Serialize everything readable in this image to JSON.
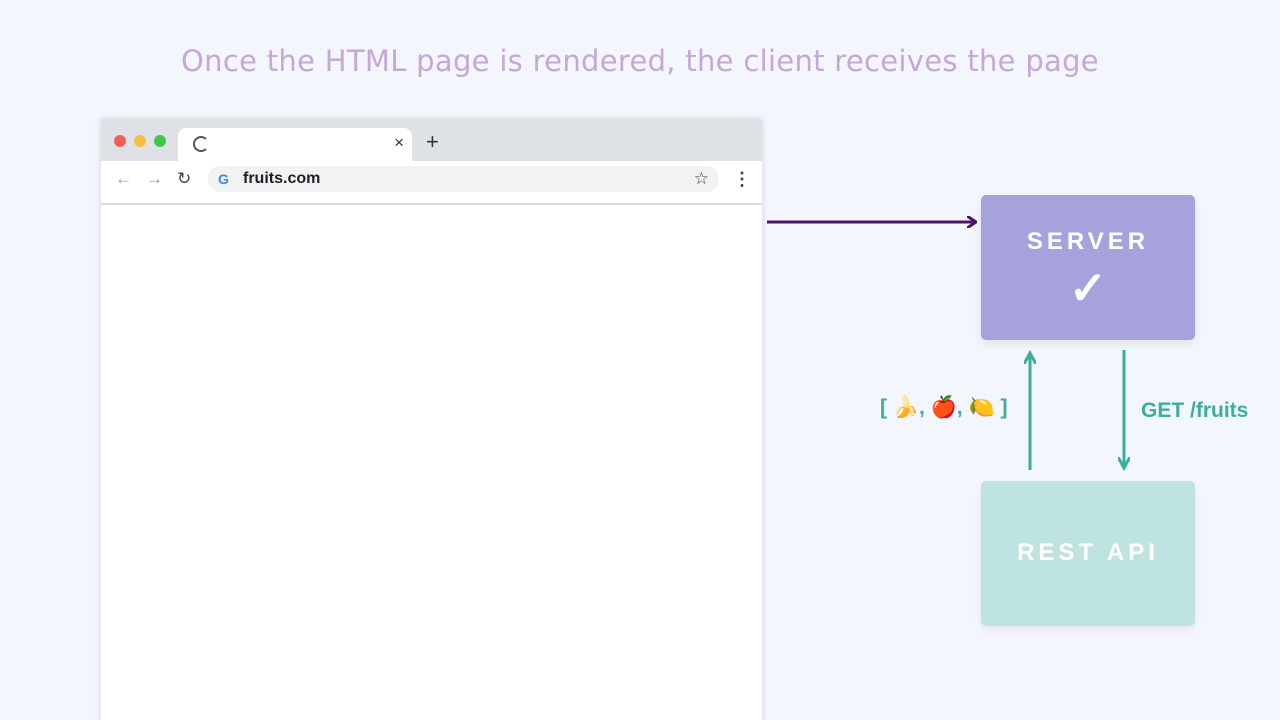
{
  "headline": "Once the HTML page is rendered, the client receives the page",
  "browser": {
    "tab_close": "×",
    "new_tab": "+",
    "back": "←",
    "forward": "→",
    "reload": "↻",
    "google_logo": "G",
    "url": "fruits.com",
    "star": "☆",
    "menu": "⋮"
  },
  "server": {
    "label": "SERVER",
    "check": "✓"
  },
  "api": {
    "label": "REST API"
  },
  "response_label": "[ 🍌, 🍎, 🍋 ]",
  "request_label": "GET /fruits",
  "colors": {
    "background": "#f3f6fc",
    "headline": "#c7a7d8",
    "server_box": "#a6a2db",
    "api_box": "#bfe3e0",
    "arrow_purple": "#4a1565",
    "arrow_teal": "#3aaf9e"
  },
  "icons": [
    "loading-spinner-icon",
    "close-icon",
    "plus-icon",
    "back-arrow-icon",
    "forward-arrow-icon",
    "reload-icon",
    "google-icon",
    "star-icon",
    "more-vert-icon",
    "checkmark-icon"
  ]
}
